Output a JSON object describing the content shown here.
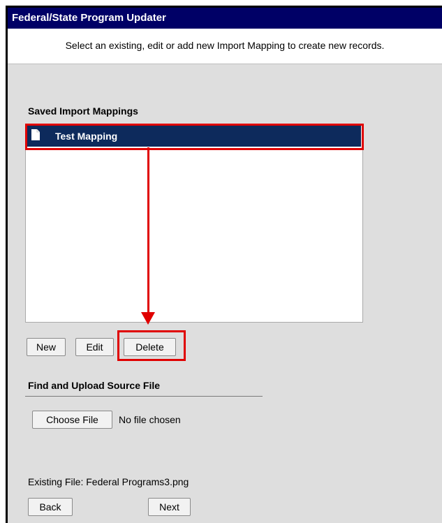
{
  "window": {
    "title": "Federal/State Program Updater",
    "subtitle": "Select an existing, edit or add new Import Mapping to create new records."
  },
  "mappings": {
    "label": "Saved Import Mappings",
    "items": [
      {
        "label": "Test Mapping",
        "selected": true
      }
    ],
    "buttons": {
      "new_label": "New",
      "edit_label": "Edit",
      "delete_label": "Delete"
    }
  },
  "upload": {
    "label": "Find and Upload Source File",
    "choose_label": "Choose File",
    "status_text": "No file chosen"
  },
  "existing_file": {
    "text": "Existing File: Federal Programs3.png"
  },
  "nav": {
    "back_label": "Back",
    "next_label": "Next"
  },
  "colors": {
    "title_bar": "#000066",
    "selected_item": "#0d2a5c",
    "annotation": "#e00000",
    "panel": "#dedede"
  }
}
